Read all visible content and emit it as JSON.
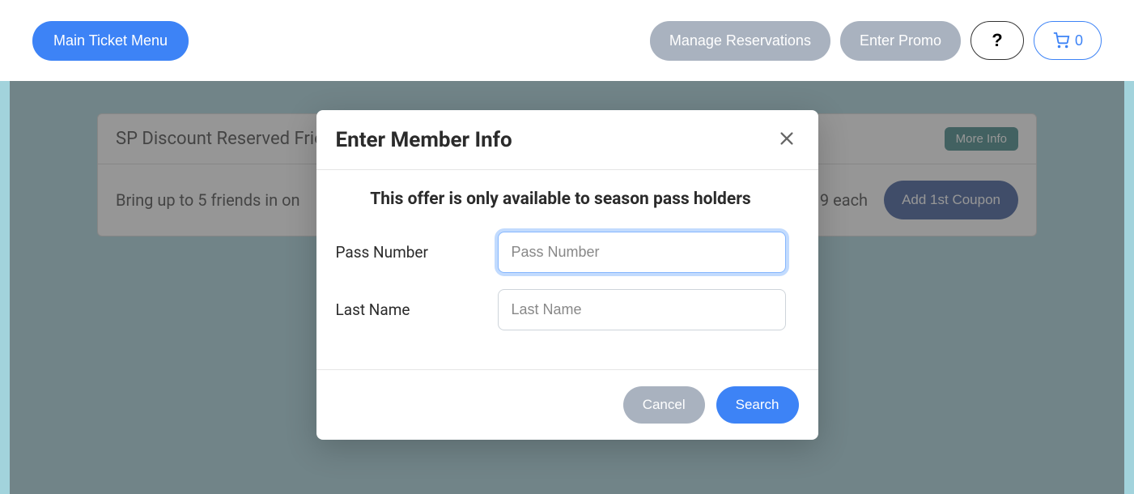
{
  "header": {
    "main_menu_label": "Main Ticket Menu",
    "manage_reservations_label": "Manage Reservations",
    "enter_promo_label": "Enter Promo",
    "help_label": "?",
    "cart_count": "0"
  },
  "ticket": {
    "title": "SP Discount Reserved Friend",
    "more_info_label": "More Info",
    "description": "Bring up to 5 friends in on",
    "price_suffix": "9 each",
    "add_coupon_label": "Add 1st Coupon"
  },
  "modal": {
    "title": "Enter Member Info",
    "subtitle": "This offer is only available to season pass holders",
    "pass_number_label": "Pass Number",
    "pass_number_placeholder": "Pass Number",
    "last_name_label": "Last Name",
    "last_name_placeholder": "Last Name",
    "cancel_label": "Cancel",
    "search_label": "Search"
  }
}
